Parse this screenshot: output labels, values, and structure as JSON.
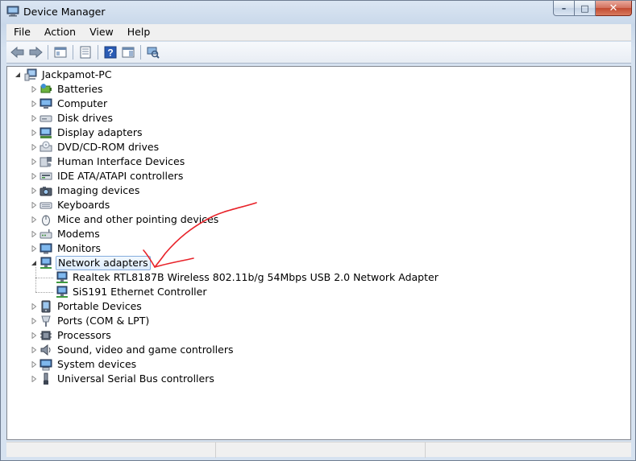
{
  "window": {
    "title": "Device Manager"
  },
  "menu": [
    "File",
    "Action",
    "View",
    "Help"
  ],
  "toolbar": [
    "back-arrow-icon",
    "forward-arrow-icon",
    "show-hide-tree-icon",
    "properties-icon",
    "help-icon",
    "action-pane-icon",
    "scan-hardware-icon"
  ],
  "tree": {
    "root": "Jackpamot-PC",
    "categories": [
      {
        "label": "Batteries",
        "icon": "battery-icon",
        "expanded": false
      },
      {
        "label": "Computer",
        "icon": "computer-icon",
        "expanded": false
      },
      {
        "label": "Disk drives",
        "icon": "disk-drive-icon",
        "expanded": false
      },
      {
        "label": "Display adapters",
        "icon": "display-adapter-icon",
        "expanded": false
      },
      {
        "label": "DVD/CD-ROM drives",
        "icon": "dvd-drive-icon",
        "expanded": false
      },
      {
        "label": "Human Interface Devices",
        "icon": "hid-icon",
        "expanded": false
      },
      {
        "label": "IDE ATA/ATAPI controllers",
        "icon": "ide-controller-icon",
        "expanded": false
      },
      {
        "label": "Imaging devices",
        "icon": "camera-icon",
        "expanded": false
      },
      {
        "label": "Keyboards",
        "icon": "keyboard-icon",
        "expanded": false
      },
      {
        "label": "Mice and other pointing devices",
        "icon": "mouse-icon",
        "expanded": false
      },
      {
        "label": "Modems",
        "icon": "modem-icon",
        "expanded": false
      },
      {
        "label": "Monitors",
        "icon": "monitor-icon",
        "expanded": false
      },
      {
        "label": "Network adapters",
        "icon": "network-adapter-icon",
        "expanded": true,
        "selected": true,
        "children": [
          "Realtek RTL8187B Wireless 802.11b/g 54Mbps USB 2.0 Network Adapter",
          "SiS191 Ethernet Controller"
        ]
      },
      {
        "label": "Portable Devices",
        "icon": "portable-device-icon",
        "expanded": false
      },
      {
        "label": "Ports (COM & LPT)",
        "icon": "port-icon",
        "expanded": false
      },
      {
        "label": "Processors",
        "icon": "processor-icon",
        "expanded": false
      },
      {
        "label": "Sound, video and game controllers",
        "icon": "speaker-icon",
        "expanded": false
      },
      {
        "label": "System devices",
        "icon": "system-device-icon",
        "expanded": false
      },
      {
        "label": "Universal Serial Bus controllers",
        "icon": "usb-icon",
        "expanded": false
      }
    ]
  },
  "colors": {
    "selection_border": "#84acdd",
    "annotation": "#e8232a"
  }
}
